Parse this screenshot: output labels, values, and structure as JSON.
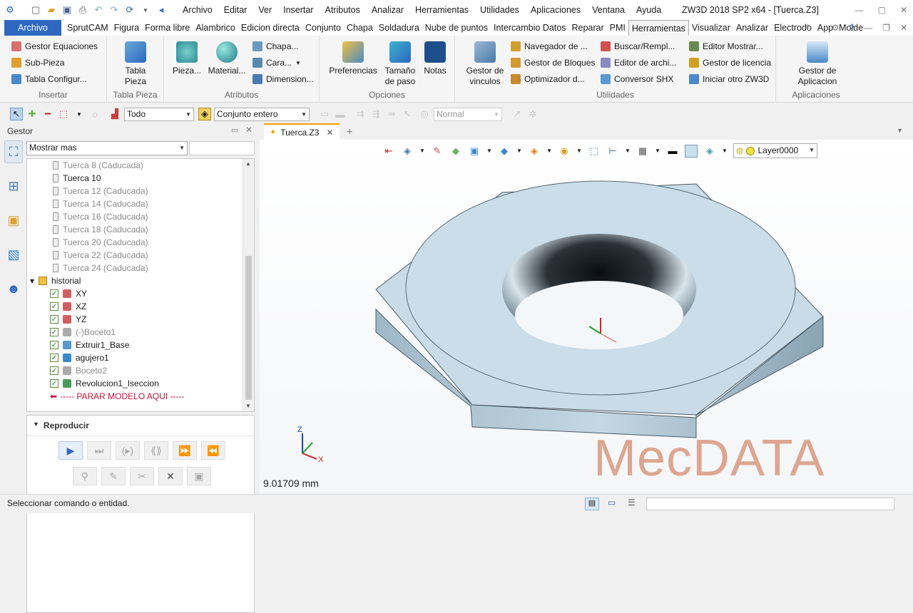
{
  "app": {
    "title": "ZW3D 2018 SP2 x64 - [Tuerca.Z3]",
    "menus": [
      "Archivo",
      "Editar",
      "Ver",
      "Insertar",
      "Atributos",
      "Analizar",
      "Herramientas",
      "Utilidades",
      "Aplicaciones",
      "Ventana",
      "Ayuda"
    ]
  },
  "ribbon_tabs": {
    "file": "Archivo",
    "tabs": [
      "SprutCAM",
      "Figura",
      "Forma libre",
      "Alambrico",
      "Edicion directa",
      "Conjunto",
      "Chapa",
      "Soldadura",
      "Nube de puntos",
      "Intercambio Datos",
      "Reparar",
      "PMI",
      "Herramientas",
      "Visualizar",
      "Analizar",
      "Electrodo",
      "App",
      "Molde"
    ],
    "active": "Herramientas"
  },
  "ribbon": {
    "insertar": {
      "items": [
        "Gestor Equaciones",
        "Sub-Pieza",
        "Tabla Configur..."
      ],
      "label": "Insertar"
    },
    "tabla_pieza": {
      "big": "Tabla Pieza",
      "label": "Tabla Pieza"
    },
    "atributos": {
      "pieza": "Pieza...",
      "material": "Material...",
      "items": [
        "Chapa...",
        "Cara...",
        "Dimension..."
      ],
      "label": "Atributos"
    },
    "opciones": {
      "preferencias": "Preferencias",
      "tamano": "Tamaño de paso",
      "notas": "Notas",
      "label": "Opciones"
    },
    "utilidades": {
      "gestor_vinculos": "Gestor de vinculos",
      "col1": [
        "Navegador de ...",
        "Gestor de Bloques",
        "Optimizador d..."
      ],
      "col2": [
        "Buscar/Rempl...",
        "Editor de archi...",
        "Conversor SHX"
      ],
      "col3": [
        "Editor Mostrar...",
        "Gestor de licencia",
        "Iniciar otro ZW3D"
      ],
      "label": "Utilidades"
    },
    "aplicaciones": {
      "gestor": "Gestor de Aplicacion",
      "label": "Aplicaciones"
    }
  },
  "toolbar": {
    "filter": "Todo",
    "scope": "Conjunto entero",
    "mode": "Normal"
  },
  "manager": {
    "title": "Gestor",
    "show_combo": "Mostrar mas",
    "tree": [
      {
        "label": "Tuerca 8 (Caducada)",
        "dim": true
      },
      {
        "label": "Tuerca 10",
        "dim": false
      },
      {
        "label": "Tuerca 12 (Caducada)",
        "dim": true
      },
      {
        "label": "Tuerca 14 (Caducada)",
        "dim": true
      },
      {
        "label": "Tuerca 16 (Caducada)",
        "dim": true
      },
      {
        "label": "Tuerca 18 (Caducada)",
        "dim": true
      },
      {
        "label": "Tuerca 20 (Caducada)",
        "dim": true
      },
      {
        "label": "Tuerca 22 (Caducada)",
        "dim": true
      },
      {
        "label": "Tuerca 24 (Caducada)",
        "dim": true
      }
    ],
    "historial": {
      "label": "historial",
      "items": [
        {
          "label": "XY",
          "dim": false
        },
        {
          "label": "XZ",
          "dim": false
        },
        {
          "label": "YZ",
          "dim": false
        },
        {
          "label": "(-)Boceto1",
          "dim": true
        },
        {
          "label": "Extruir1_Base",
          "dim": false
        },
        {
          "label": "agujero1",
          "dim": false
        },
        {
          "label": "Boceto2",
          "dim": true
        },
        {
          "label": "Revolucion1_Iseccion",
          "dim": false
        }
      ],
      "stop": "----- PARAR MODELO AQUI -----"
    },
    "reproducir": "Reproducir"
  },
  "document": {
    "tab": "Tuerca.Z3",
    "layer": "Layer0000",
    "measure": "9.01709 mm",
    "watermark": "MecDATA"
  },
  "status": {
    "message": "Seleccionar comando o entidad."
  },
  "colors": {
    "accent": "#2e68c0",
    "nut_top": "#c9dbe6",
    "nut_side": "#a9c1d0",
    "stop_red": "#c0143c"
  }
}
